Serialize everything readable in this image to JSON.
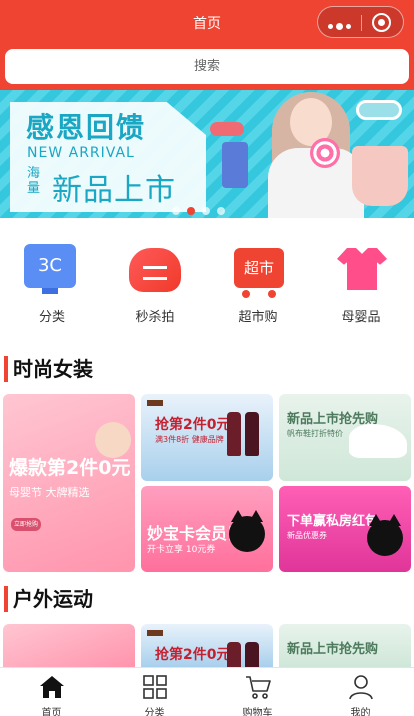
{
  "header": {
    "title": "首页",
    "search_placeholder": "搜索",
    "accent_color": "#f04433"
  },
  "banner": {
    "title": "感恩回馈",
    "subtitle": "NEW ARRIVAL",
    "side_text": "海量",
    "headline": "新品上市",
    "slide_count": 4,
    "active_slide": 2
  },
  "categories": [
    {
      "label": "分类",
      "icon": "3c-monitor-icon"
    },
    {
      "label": "秒杀拍",
      "icon": "flash-sale-icon"
    },
    {
      "label": "超市购",
      "icon": "supermarket-cart-icon",
      "icon_text": "超市"
    },
    {
      "label": "母婴品",
      "icon": "baby-shirt-icon"
    }
  ],
  "icon_3c_text": "3C",
  "sections": [
    {
      "title": "时尚女装"
    },
    {
      "title": "户外运动"
    }
  ],
  "tiles": {
    "big": {
      "promo": "爆款第2件0元",
      "sub": "母婴节 大牌精选",
      "btn": "立即抢购"
    },
    "wine": {
      "headline": "抢第2件0元",
      "sub": "满3件8折 健康品牌"
    },
    "shoe": {
      "headline": "新品上市抢先购",
      "sub": "帆布鞋打折特价"
    },
    "cat1": {
      "headline": "妙宝卡会员日",
      "sub": "开卡立享 10元券"
    },
    "cat2": {
      "headline": "下单赢私房红包",
      "sub": "新品优惠券"
    }
  },
  "tabbar": [
    {
      "label": "首页",
      "icon": "home-icon",
      "active": true
    },
    {
      "label": "分类",
      "icon": "grid-icon",
      "active": false
    },
    {
      "label": "购物车",
      "icon": "cart-icon",
      "active": false
    },
    {
      "label": "我的",
      "icon": "user-icon",
      "active": false
    }
  ]
}
